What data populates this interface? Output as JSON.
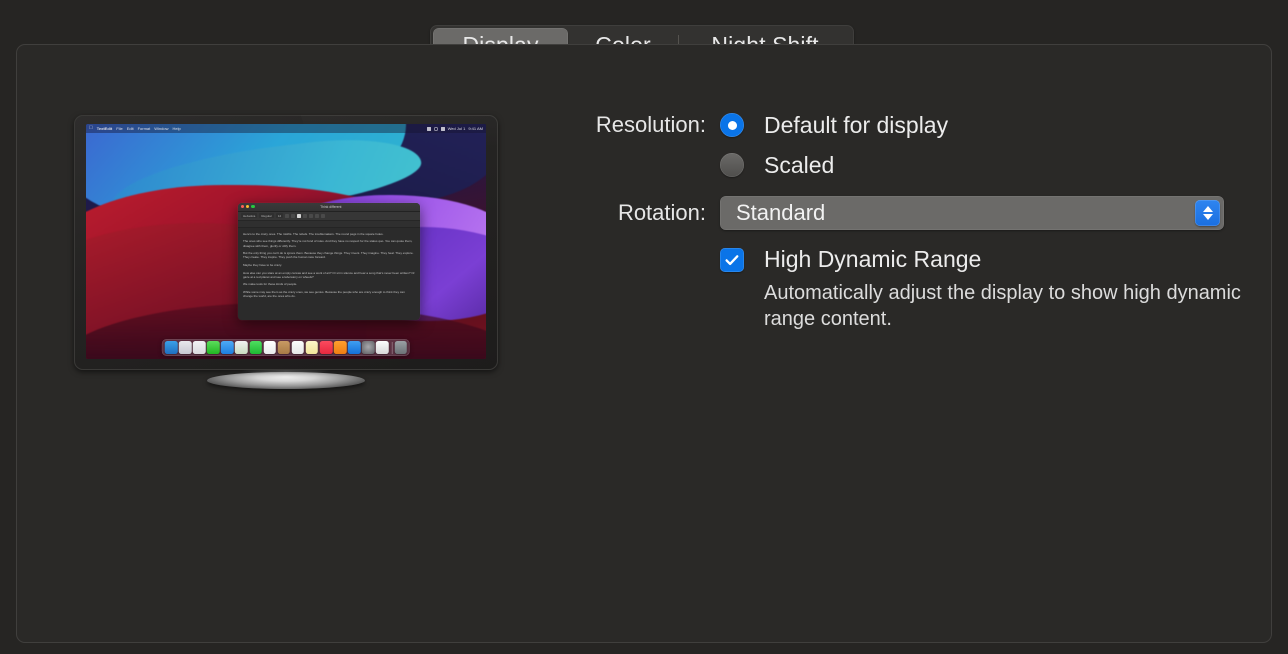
{
  "tabs": [
    {
      "label": "Display",
      "selected": true
    },
    {
      "label": "Color",
      "selected": false
    },
    {
      "label": "Night Shift",
      "selected": false
    }
  ],
  "form": {
    "resolution_label": "Resolution:",
    "resolution_options": [
      {
        "label": "Default for display",
        "selected": true
      },
      {
        "label": "Scaled",
        "selected": false
      }
    ],
    "rotation_label": "Rotation:",
    "rotation_value": "Standard",
    "hdr_label": "High Dynamic Range",
    "hdr_checked": true,
    "hdr_description": "Automatically adjust the display to show high dynamic range content."
  },
  "preview": {
    "menubar": {
      "apple": "",
      "items": [
        "TextEdit",
        "File",
        "Edit",
        "Format",
        "Window",
        "Help"
      ],
      "status_date": "Wed Jul 1",
      "status_time": "9:41 AM"
    },
    "window": {
      "title": "Think different",
      "font_name": "Helvetica",
      "font_style": "Regular",
      "font_size": "12",
      "paragraphs": [
        "Here's to the crazy ones. The misfits. The rebels. The troublemakers. The round pegs in the square holes.",
        "The ones who see things differently. They're not fond of rules. And they have no respect for the status quo. You can quote them, disagree with them, glorify or vilify them.",
        "But the only thing you can't do is ignore them. Because they change things. They invent. They imagine. They heal. They explore. They create. They inspire. They push the human race forward.",
        "Maybe they have to be crazy.",
        "How else can you stare at an empty canvas and see a work of art? Or sit in silence and hear a song that's never been written? Or gaze at a red planet and see a laboratory on wheels?",
        "We make tools for these kinds of people.",
        "While some may see them as the crazy ones, we see genius. Because the people who are crazy enough to think they can change the world, are the ones who do."
      ]
    },
    "dock": [
      {
        "name": "finder-icon",
        "colors": [
          "#3aa0e8",
          "#1f6fc0"
        ]
      },
      {
        "name": "launchpad-icon",
        "colors": [
          "#e8e8ec",
          "#c9c9d2"
        ]
      },
      {
        "name": "safari-icon",
        "colors": [
          "#f2f2f4",
          "#dadade"
        ]
      },
      {
        "name": "messages-icon",
        "colors": [
          "#5cdc5c",
          "#22b622"
        ]
      },
      {
        "name": "mail-icon",
        "colors": [
          "#4ea9f5",
          "#1d7fe0"
        ]
      },
      {
        "name": "maps-icon",
        "colors": [
          "#f0f0f2",
          "#c9dcc0"
        ]
      },
      {
        "name": "facetime-icon",
        "colors": [
          "#4ede60",
          "#1fb832"
        ]
      },
      {
        "name": "calendar-icon",
        "colors": [
          "#ffffff",
          "#eaeaea"
        ]
      },
      {
        "name": "photos-icon",
        "colors": [
          "#c89a63",
          "#a97b46"
        ]
      },
      {
        "name": "reminders-icon",
        "colors": [
          "#fcfcfc",
          "#e6e6e6"
        ]
      },
      {
        "name": "notes-icon",
        "colors": [
          "#fcf4c8",
          "#f2e49a"
        ]
      },
      {
        "name": "music-icon",
        "colors": [
          "#fb4a5e",
          "#e8283f"
        ]
      },
      {
        "name": "books-icon",
        "colors": [
          "#ff9f2e",
          "#f07d12"
        ]
      },
      {
        "name": "appstore-icon",
        "colors": [
          "#3f9ef0",
          "#1470d8"
        ]
      },
      {
        "name": "system-preferences-icon",
        "colors": [
          "#8e8e92",
          "#5a5a5e"
        ]
      },
      {
        "name": "textedit-icon",
        "colors": [
          "#fcfcfc",
          "#d8d8d8"
        ]
      },
      {
        "name": "trash-icon",
        "colors": [
          "#9aa0a4",
          "#6c7276"
        ]
      }
    ]
  },
  "colors": {
    "window_bg": "#262523",
    "panel_bg": "#2a2927",
    "accent_blue": "#0a74e8",
    "tab_selected_bg": "#6b6a68",
    "popup_bg": "#6b6a68",
    "text_primary": "#ececec"
  }
}
